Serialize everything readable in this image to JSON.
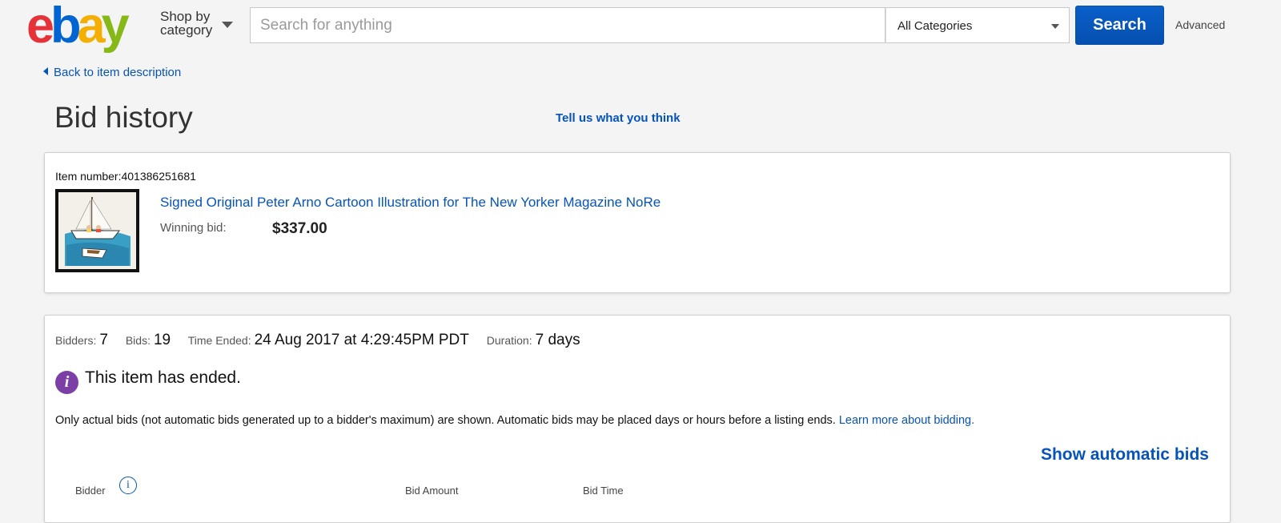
{
  "header": {
    "logo_letters": [
      "e",
      "b",
      "a",
      "y"
    ],
    "logo_colors": [
      "#e53238",
      "#0064d2",
      "#f5af02",
      "#86b817"
    ],
    "shop_by_line1": "Shop by",
    "shop_by_line2": "category",
    "search_placeholder": "Search for anything",
    "category_selected": "All Categories",
    "search_button": "Search",
    "advanced": "Advanced",
    "accent": "#0654ba"
  },
  "nav": {
    "back_link": "Back to item description"
  },
  "page": {
    "title": "Bid history",
    "feedback_link": "Tell us what you think"
  },
  "item": {
    "number_label": "Item number:",
    "number": "401386251681",
    "title": "Signed Original Peter Arno Cartoon Illustration for The New Yorker Magazine NoRe",
    "winning_bid_label": "Winning bid:",
    "winning_bid": "$337.00"
  },
  "summary": {
    "bidders_label": "Bidders:",
    "bidders": "7",
    "bids_label": "Bids:",
    "bids": "19",
    "time_ended_label": "Time Ended:",
    "time_ended": "24 Aug 2017 at 4:29:45PM PDT",
    "duration_label": "Duration:",
    "duration": "7 days",
    "ended_message": "This item has ended.",
    "note": "Only actual bids (not automatic bids generated up to a bidder's maximum) are shown. Automatic bids may be placed days or hours before a listing ends.",
    "learn_more": "Learn more about bidding.",
    "show_automatic": "Show automatic bids"
  },
  "table": {
    "columns": [
      "Bidder",
      "Bid Amount",
      "Bid Time"
    ]
  }
}
